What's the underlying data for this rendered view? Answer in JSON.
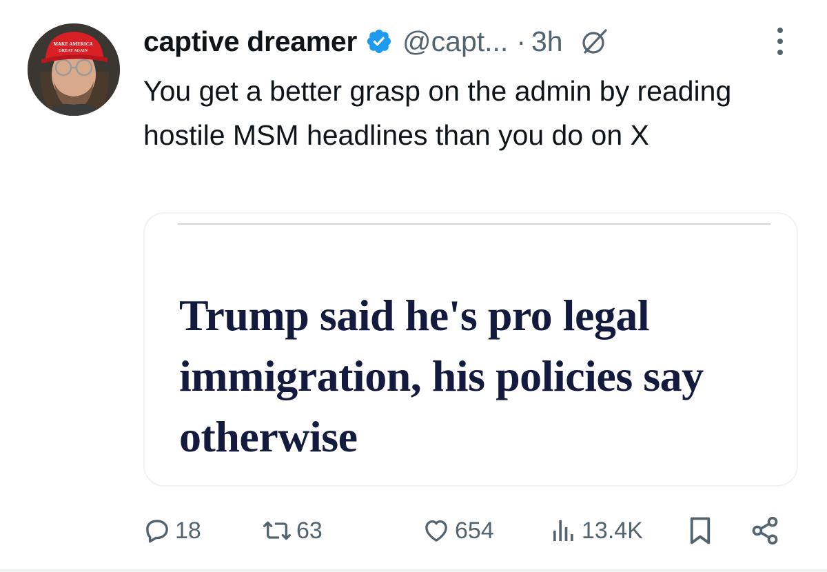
{
  "user": {
    "display_name": "captive dreamer",
    "handle": "@capt...",
    "separator": "·",
    "time": "3h",
    "verified": true,
    "avatar_hat_text": "MAKE AMERICA GREAT AGAIN",
    "icons": {
      "verified": "verified-badge-icon",
      "grok": "grok-icon",
      "more": "more-options-icon"
    }
  },
  "tweet": {
    "text": "You get a better grasp on the admin by reading hostile MSM headlines than you do on X"
  },
  "media": {
    "headline": "Trump said he's pro legal immigration, his policies say otherwise"
  },
  "actions": {
    "replies": "18",
    "reposts": "63",
    "likes": "654",
    "views": "13.4K",
    "icons": {
      "replies": "reply-icon",
      "reposts": "repost-icon",
      "likes": "heart-icon",
      "views": "views-icon",
      "bookmark": "bookmark-icon",
      "share": "share-icon"
    }
  },
  "colors": {
    "text_primary": "#0f1419",
    "text_secondary": "#536471",
    "verified_blue": "#1d9bf0",
    "headline_navy": "#121b3e",
    "hat_red": "#d81f26"
  }
}
